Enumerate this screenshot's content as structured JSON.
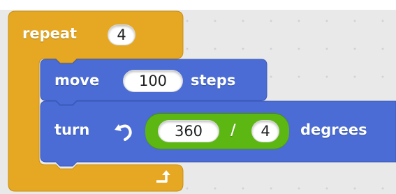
{
  "colors": {
    "control": "#e6a822",
    "motion": "#4a6cd4",
    "operators": "#5cb712",
    "canvas": "#e9e9e9"
  },
  "repeat_block": {
    "label": "repeat",
    "count": "4"
  },
  "move_block": {
    "label": "move",
    "steps_value": "100",
    "suffix": "steps"
  },
  "turn_block": {
    "label": "turn",
    "icon": "rotate-left-icon",
    "divide": {
      "left": "360",
      "operator": "/",
      "right": "4"
    },
    "suffix": "degrees"
  },
  "repeat_end_icon": "loop-arrow-icon"
}
